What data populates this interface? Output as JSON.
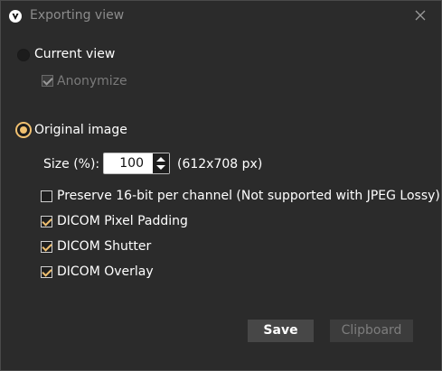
{
  "window": {
    "title": "Exporting view",
    "app_icon": "app-logo-icon",
    "close_icon": "close-icon"
  },
  "export_mode": {
    "current_view_label": "Current view",
    "current_view_selected": false,
    "anonymize_label": "Anonymize",
    "anonymize_checked": true,
    "anonymize_enabled": false,
    "original_image_label": "Original image",
    "original_image_selected": true
  },
  "size": {
    "label": "Size (%):",
    "value": "100",
    "dimensions": "(612x708 px)"
  },
  "options": [
    {
      "label": "Preserve 16-bit per channel (Not supported with JPEG Lossy)",
      "checked": false
    },
    {
      "label": "DICOM Pixel Padding",
      "checked": true
    },
    {
      "label": "DICOM Shutter",
      "checked": true
    },
    {
      "label": "DICOM Overlay",
      "checked": true
    }
  ],
  "buttons": {
    "save_label": "Save",
    "clipboard_label": "Clipboard",
    "clipboard_enabled": false
  },
  "colors": {
    "accent": "#f0c070",
    "background": "#2b2b2b",
    "disabled_text": "#7a7a7a"
  }
}
